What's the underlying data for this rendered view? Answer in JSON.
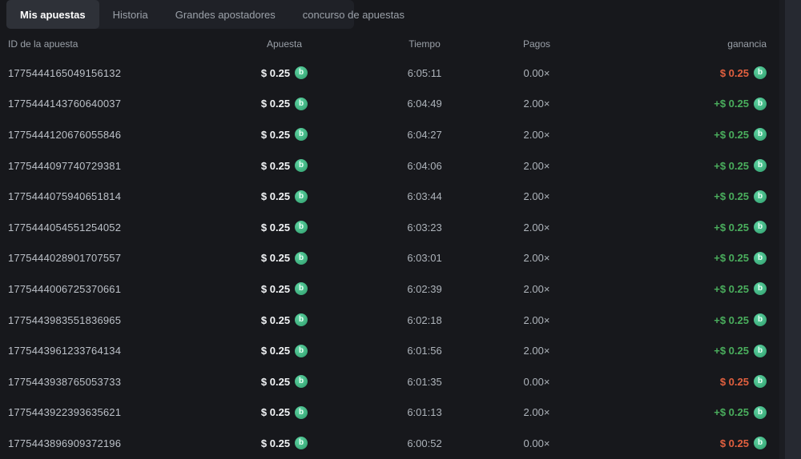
{
  "tabs": [
    {
      "label": "Mis apuestas",
      "active": true
    },
    {
      "label": "Historia",
      "active": false
    },
    {
      "label": "Grandes apostadores",
      "active": false
    },
    {
      "label": "concurso de apuestas",
      "active": false
    }
  ],
  "table": {
    "columns": [
      "ID de la apuesta",
      "Apuesta",
      "Tiempo",
      "Pagos",
      "ganancia"
    ],
    "rows": [
      {
        "id": "1775444165049156132",
        "bet": "$ 0.25",
        "time": "6:05:11",
        "payout": "0.00×",
        "profit": "$ 0.25",
        "result": "loss"
      },
      {
        "id": "1775444143760640037",
        "bet": "$ 0.25",
        "time": "6:04:49",
        "payout": "2.00×",
        "profit": "+$ 0.25",
        "result": "win"
      },
      {
        "id": "1775444120676055846",
        "bet": "$ 0.25",
        "time": "6:04:27",
        "payout": "2.00×",
        "profit": "+$ 0.25",
        "result": "win"
      },
      {
        "id": "1775444097740729381",
        "bet": "$ 0.25",
        "time": "6:04:06",
        "payout": "2.00×",
        "profit": "+$ 0.25",
        "result": "win"
      },
      {
        "id": "1775444075940651814",
        "bet": "$ 0.25",
        "time": "6:03:44",
        "payout": "2.00×",
        "profit": "+$ 0.25",
        "result": "win"
      },
      {
        "id": "1775444054551254052",
        "bet": "$ 0.25",
        "time": "6:03:23",
        "payout": "2.00×",
        "profit": "+$ 0.25",
        "result": "win"
      },
      {
        "id": "1775444028901707557",
        "bet": "$ 0.25",
        "time": "6:03:01",
        "payout": "2.00×",
        "profit": "+$ 0.25",
        "result": "win"
      },
      {
        "id": "1775444006725370661",
        "bet": "$ 0.25",
        "time": "6:02:39",
        "payout": "2.00×",
        "profit": "+$ 0.25",
        "result": "win"
      },
      {
        "id": "1775443983551836965",
        "bet": "$ 0.25",
        "time": "6:02:18",
        "payout": "2.00×",
        "profit": "+$ 0.25",
        "result": "win"
      },
      {
        "id": "1775443961233764134",
        "bet": "$ 0.25",
        "time": "6:01:56",
        "payout": "2.00×",
        "profit": "+$ 0.25",
        "result": "win"
      },
      {
        "id": "1775443938765053733",
        "bet": "$ 0.25",
        "time": "6:01:35",
        "payout": "0.00×",
        "profit": "$ 0.25",
        "result": "loss"
      },
      {
        "id": "1775443922393635621",
        "bet": "$ 0.25",
        "time": "6:01:13",
        "payout": "2.00×",
        "profit": "+$ 0.25",
        "result": "win"
      },
      {
        "id": "1775443896909372196",
        "bet": "$ 0.25",
        "time": "6:00:52",
        "payout": "0.00×",
        "profit": "$ 0.25",
        "result": "loss"
      }
    ]
  },
  "icons": {
    "coin_letter": "b"
  },
  "colors": {
    "win": "#4aae5d",
    "loss": "#e2603f",
    "coin": "#3aa878",
    "active_tab_bg": "#2e3138",
    "page_bg": "#17181c"
  }
}
